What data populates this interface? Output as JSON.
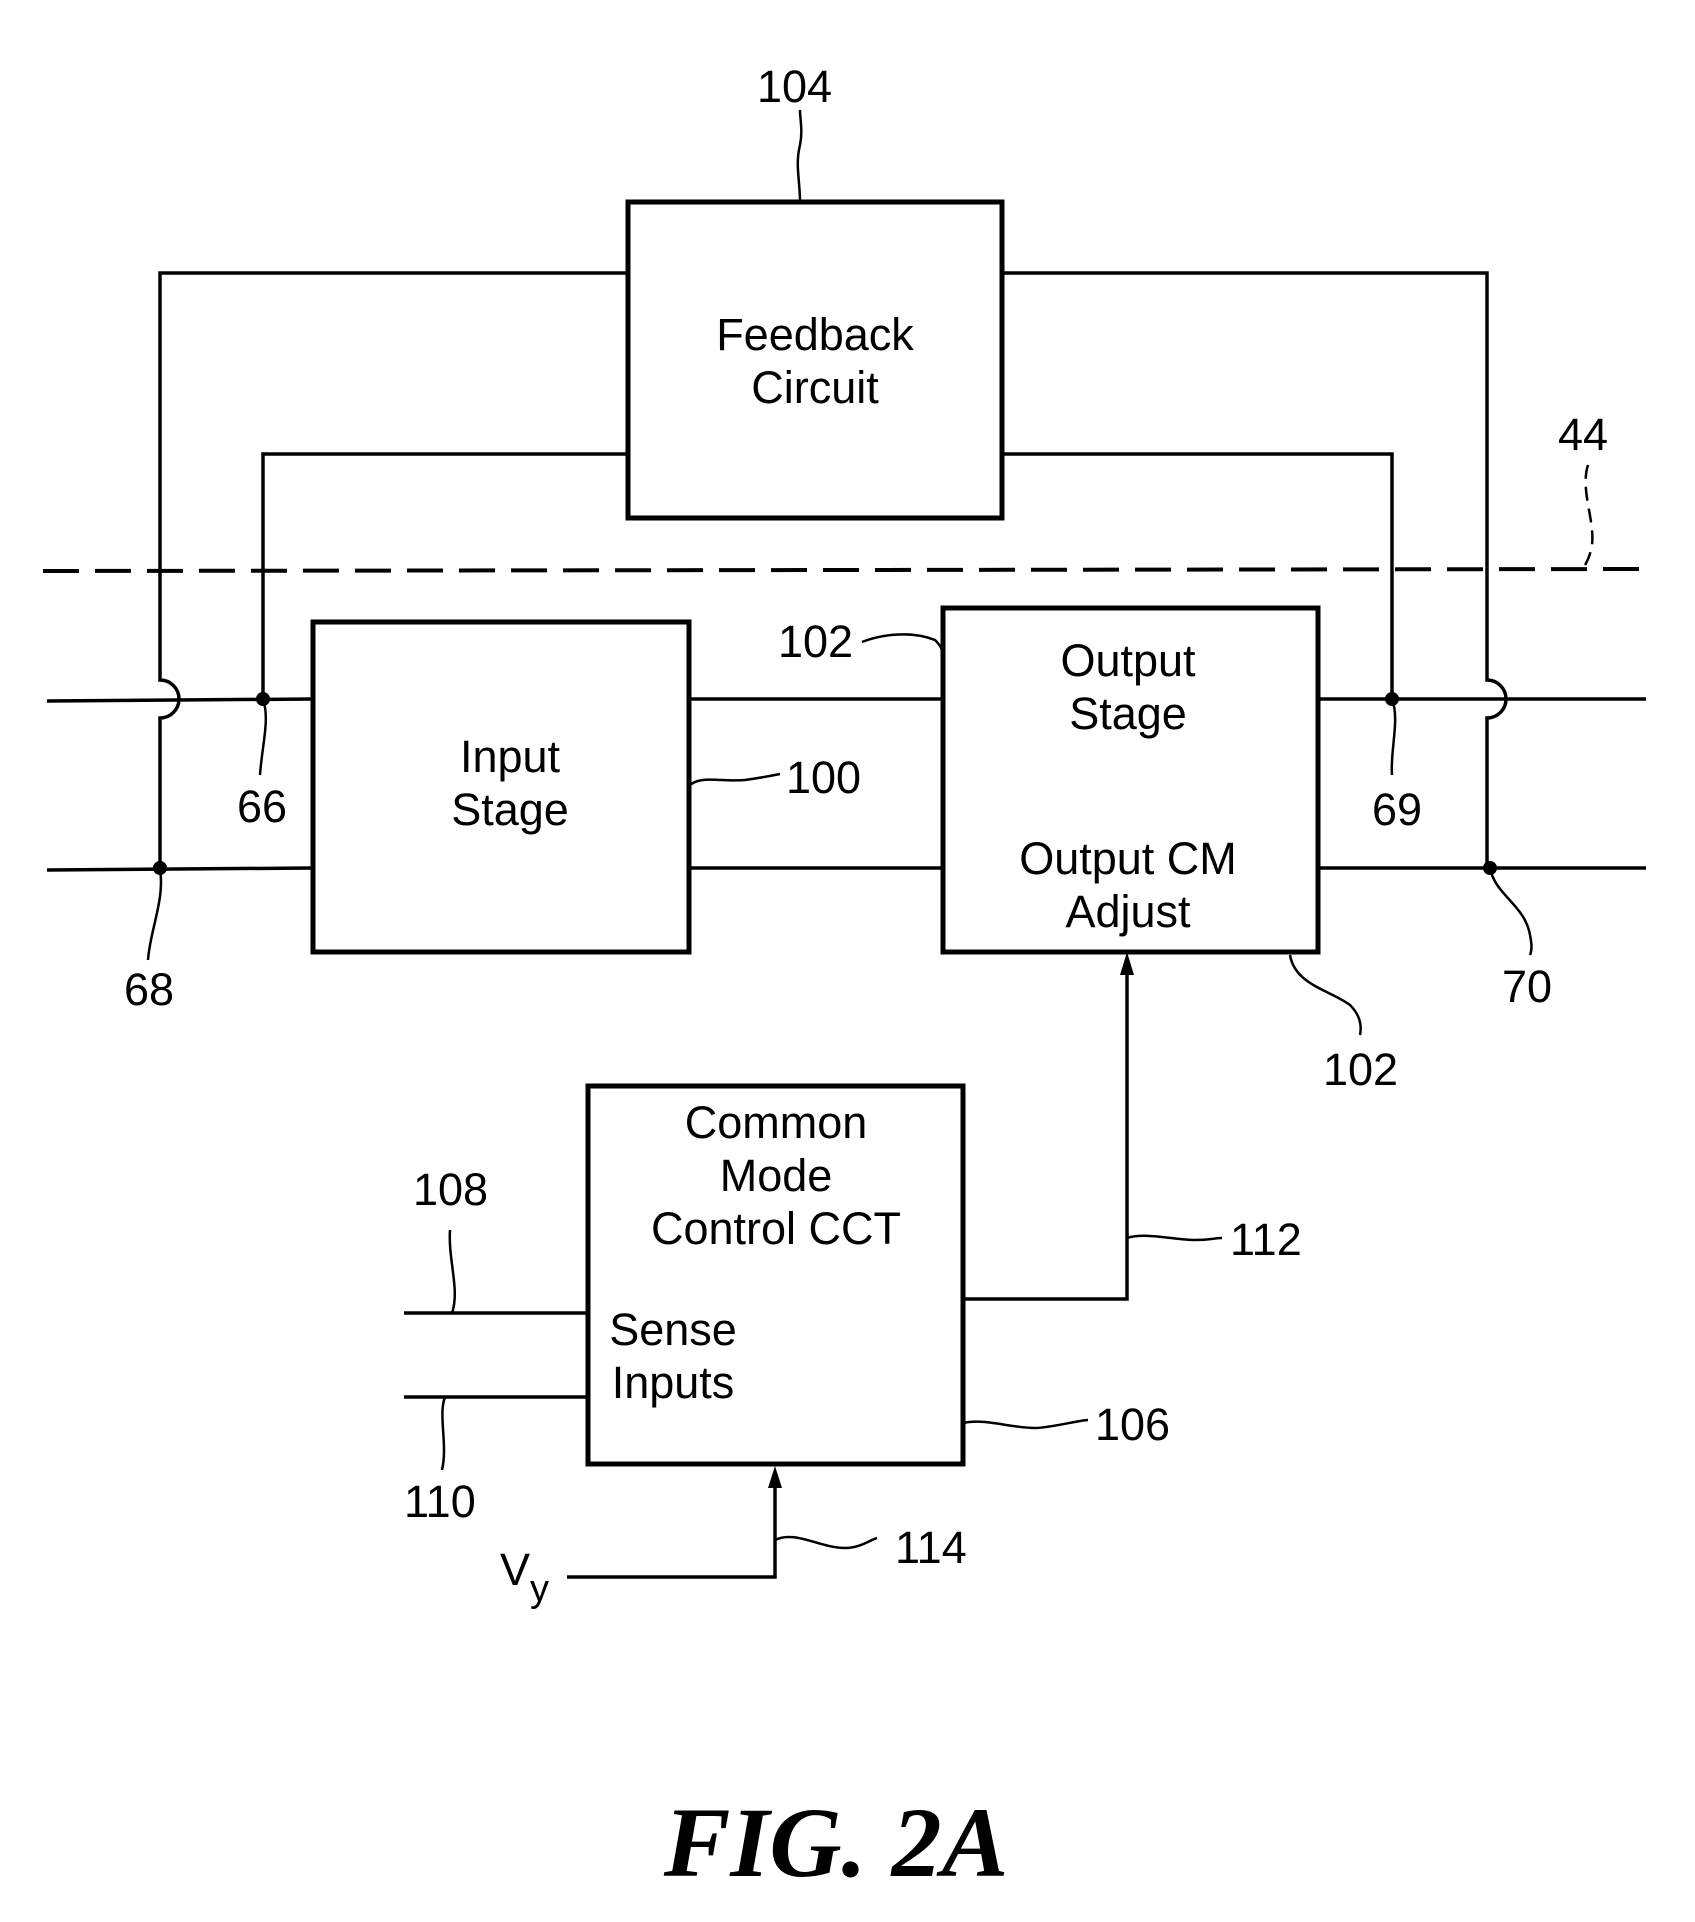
{
  "figure": {
    "caption": "FIG. 2A",
    "blocks": {
      "feedback": {
        "ref": "104",
        "lines": [
          "Feedback",
          "Circuit"
        ]
      },
      "input_stage": {
        "ref": "100",
        "lines": [
          "Input",
          "Stage"
        ]
      },
      "output_stage": {
        "ref": "102",
        "lines": [
          "Output",
          "Stage",
          "Output CM",
          "Adjust"
        ]
      },
      "cm_control": {
        "ref": "106",
        "lines": [
          "Common",
          "Mode",
          "Control CCT",
          "Sense",
          "Inputs"
        ]
      }
    },
    "labels": {
      "ref_104": "104",
      "ref_44": "44",
      "ref_102_top": "102",
      "ref_100": "100",
      "ref_66": "66",
      "ref_68": "68",
      "ref_69": "69",
      "ref_70": "70",
      "ref_102_bottom": "102",
      "ref_108": "108",
      "ref_110": "110",
      "ref_112": "112",
      "ref_106": "106",
      "ref_114": "114",
      "vy_main": "V",
      "vy_sub": "y"
    }
  }
}
